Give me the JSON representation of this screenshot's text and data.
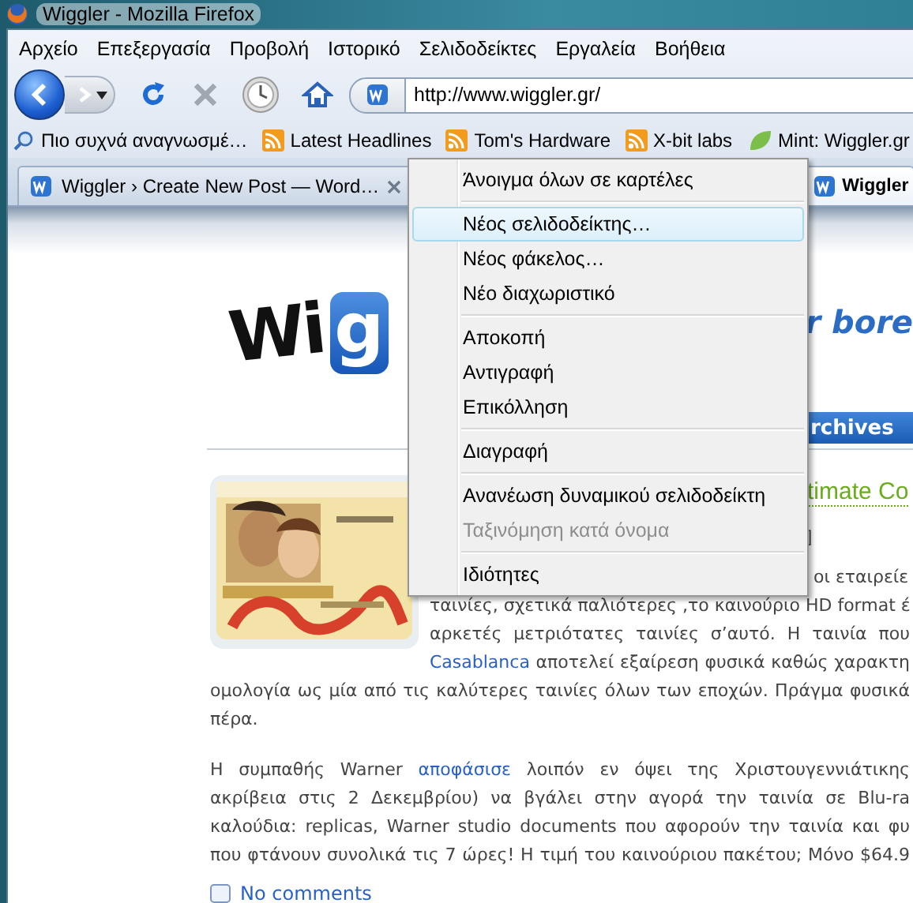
{
  "window": {
    "title": "Wiggler - Mozilla Firefox"
  },
  "menu_bar": [
    "Αρχείο",
    "Επεξεργασία",
    "Προβολή",
    "Ιστορικό",
    "Σελιδοδείκτες",
    "Εργαλεία",
    "Βοήθεια"
  ],
  "address_bar": {
    "value": "http://www.wiggler.gr/"
  },
  "bookmarks": [
    {
      "label": "Πιο συχνά αναγνωσμέ…",
      "kind": "smart"
    },
    {
      "label": "Latest Headlines",
      "kind": "feed"
    },
    {
      "label": "Tom's Hardware",
      "kind": "feed"
    },
    {
      "label": "X-bit labs",
      "kind": "feed"
    },
    {
      "label": "Mint: Wiggler.gr",
      "kind": "site"
    }
  ],
  "tabs": [
    {
      "label": "Wiggler › Create New Post — Word…",
      "selected": false,
      "closable": true
    },
    {
      "label": "Wiggler",
      "selected": true,
      "closable": false
    }
  ],
  "context_menu": {
    "items": [
      {
        "kind": "item",
        "label": "Άνοιγμα όλων σε καρτέλες",
        "selected": false,
        "disabled": false
      },
      {
        "kind": "separator"
      },
      {
        "kind": "item",
        "label": "Νέος σελιδοδείκτης…",
        "selected": true,
        "disabled": false
      },
      {
        "kind": "item",
        "label": "Νέος φάκελος…",
        "selected": false,
        "disabled": false
      },
      {
        "kind": "item",
        "label": "Νέο διαχωριστικό",
        "selected": false,
        "disabled": false
      },
      {
        "kind": "separator"
      },
      {
        "kind": "item",
        "label": "Αποκοπή",
        "selected": false,
        "disabled": false
      },
      {
        "kind": "item",
        "label": "Αντιγραφή",
        "selected": false,
        "disabled": false
      },
      {
        "kind": "item",
        "label": "Επικόλληση",
        "selected": false,
        "disabled": false
      },
      {
        "kind": "separator"
      },
      {
        "kind": "item",
        "label": "Διαγραφή",
        "selected": false,
        "disabled": false
      },
      {
        "kind": "separator"
      },
      {
        "kind": "item",
        "label": "Ανανέωση δυναμικού σελιδοδείκτη",
        "selected": false,
        "disabled": false
      },
      {
        "kind": "item",
        "label": "Ταξινόμηση κατά όνομα",
        "selected": false,
        "disabled": true
      },
      {
        "kind": "separator"
      },
      {
        "kind": "item",
        "label": "Ιδιότητες",
        "selected": false,
        "disabled": false
      }
    ]
  },
  "page": {
    "logo": {
      "dark_text": "Wi",
      "box_text": "g"
    },
    "tagline": "r bore",
    "nav_tab": "rchives",
    "post": {
      "title": "timate Co",
      "meta": "]",
      "lines_beside_image": [
        [
          {
            "text": "οι εταιρείε"
          }
        ],
        [
          {
            "text": "ταινίες, σχετικά παλιότερες ,το καινούριο HD format έ"
          }
        ],
        [
          {
            "text": "αρκετές μετριότατες ταινίες σ’αυτό. Η ταινία που"
          }
        ],
        [
          {
            "text": "Casablanca",
            "link": true
          },
          {
            "text": " αποτελεί εξαίρεση φυσικά καθώς χαρακτη"
          }
        ]
      ],
      "lines_full": [
        [
          {
            "text": "ομολογία ως μία από τις καλύτερες ταινίες όλων των εποχών. Πράγμα φυσικά"
          }
        ],
        [
          {
            "text": "πέρα."
          }
        ]
      ],
      "paragraph_2": [
        [
          {
            "text": "Η συμπαθής Warner "
          },
          {
            "text": "αποφάσισε",
            "link": true
          },
          {
            "text": " λοιπόν εν όψει της Χριστουγεννιάτικης"
          }
        ],
        [
          {
            "text": "ακρίβεια στις 2 Δεκεμβρίου) να βγάλει στην αγορά την ταινία σε Blu-ra"
          }
        ],
        [
          {
            "text": "καλούδια: replicas, Warner studio documents που αφορούν την ταινία και φυ"
          }
        ],
        [
          {
            "text": "που φτάνουν συνολικά τις 7 ώρες! Η τιμή του καινούριου πακέτου; Μόνο $64.9"
          }
        ]
      ]
    },
    "comments_link": "No comments"
  }
}
